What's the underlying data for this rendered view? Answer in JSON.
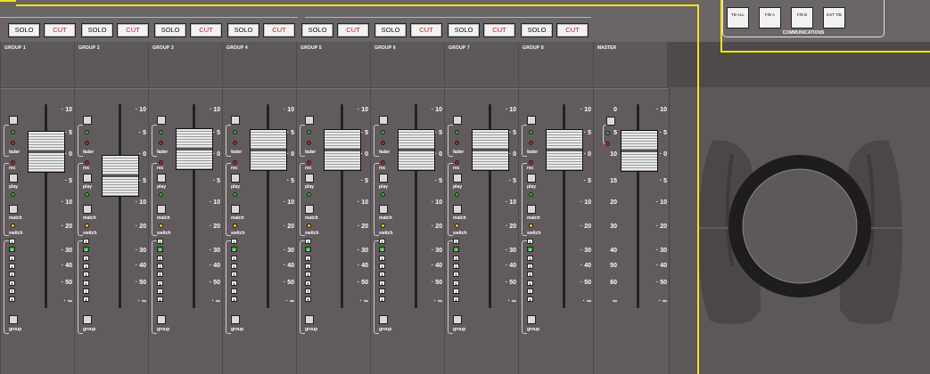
{
  "buttons": {
    "solo": "SOLO",
    "cut": "CUT"
  },
  "groups": [
    "GROUP 1",
    "GROUP 2",
    "GROUP 3",
    "GROUP 4",
    "GROUP 5",
    "GROUP 6",
    "GROUP 7",
    "GROUP 8"
  ],
  "master": {
    "name": "MASTER"
  },
  "strip_labels": {
    "fader": "fader",
    "rec": "rec",
    "play": "play",
    "match": "match",
    "switch": "switch",
    "group": "group"
  },
  "numbers": [
    "1",
    "2",
    "3",
    "4",
    "5",
    "6",
    "7",
    "8"
  ],
  "scale": [
    "10",
    "5",
    "0",
    "5",
    "10",
    "20",
    "30",
    "40",
    "50",
    "∞"
  ],
  "master_left_scale": [
    "0",
    "5",
    "10",
    "15",
    "20",
    "30",
    "40",
    "50",
    "60",
    "∞"
  ],
  "communications": {
    "label": "COMMUNICATIONS",
    "buttons": [
      "TB ALL",
      "F/B A",
      "F/B B",
      "EXT T/B"
    ]
  },
  "colors": {
    "led_green": "#2eb82e",
    "led_red": "#c61d1d",
    "led_yellow": "#e6d21a",
    "cut_text": "#d21818",
    "highlight": "#f0e516"
  }
}
